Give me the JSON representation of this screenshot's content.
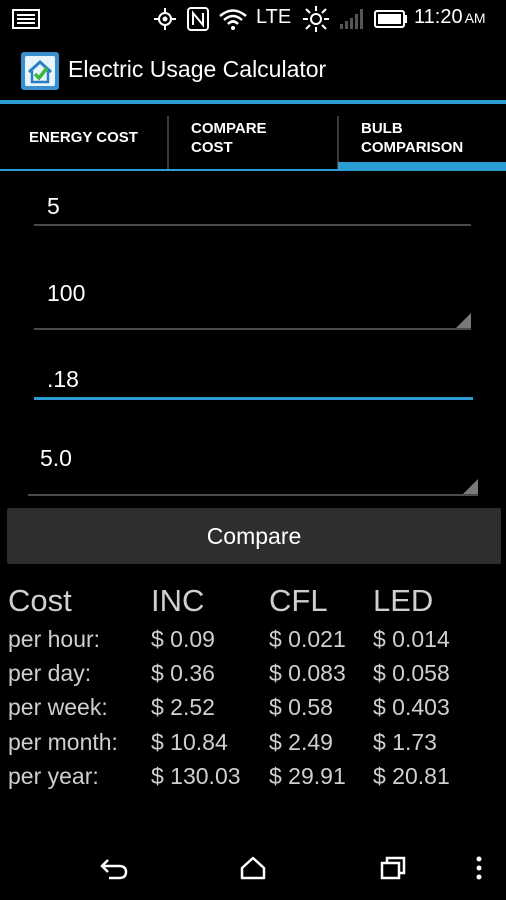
{
  "status_bar": {
    "network": "LTE",
    "time": "11:20",
    "ampm": "AM",
    "icons": [
      "notification-icon",
      "location-icon",
      "nfc-icon",
      "wifi-icon",
      "brightness-icon",
      "signal-icon",
      "battery-icon"
    ]
  },
  "action_bar": {
    "title": "Electric Usage Calculator",
    "icon": "app-house-check-icon"
  },
  "tabs": [
    {
      "label": "ENERGY COST",
      "selected": false
    },
    {
      "label": "COMPARE\nCOST",
      "selected": false
    },
    {
      "label": "BULB\nCOMPARISON",
      "selected": true
    }
  ],
  "fields": [
    {
      "value": "5"
    },
    {
      "value": "100"
    },
    {
      "value": ".18"
    },
    {
      "value": "5.0"
    }
  ],
  "compare_button": {
    "label": "Compare"
  },
  "results": {
    "headers": [
      "Cost",
      "INC",
      "CFL",
      "LED"
    ],
    "rows": [
      {
        "label": "per hour:",
        "inc": "$ 0.09",
        "cfl": "$ 0.021",
        "led": "$ 0.014"
      },
      {
        "label": "per day:",
        "inc": "$ 0.36",
        "cfl": "$ 0.083",
        "led": "$ 0.058"
      },
      {
        "label": "per week:",
        "inc": "$ 2.52",
        "cfl": "$ 0.58",
        "led": "$ 0.403"
      },
      {
        "label": "per month:",
        "inc": "$ 10.84",
        "cfl": "$ 2.49",
        "led": "$ 1.73"
      },
      {
        "label": "per year:",
        "inc": "$ 130.03",
        "cfl": "$ 29.91",
        "led": "$ 20.81"
      }
    ]
  },
  "nav_bar": {
    "buttons": [
      "back-icon",
      "home-icon",
      "recents-icon",
      "menu-icon"
    ]
  },
  "colors": {
    "accent": "#2b9dd2",
    "background": "#000000",
    "button": "#2e2e2e"
  }
}
